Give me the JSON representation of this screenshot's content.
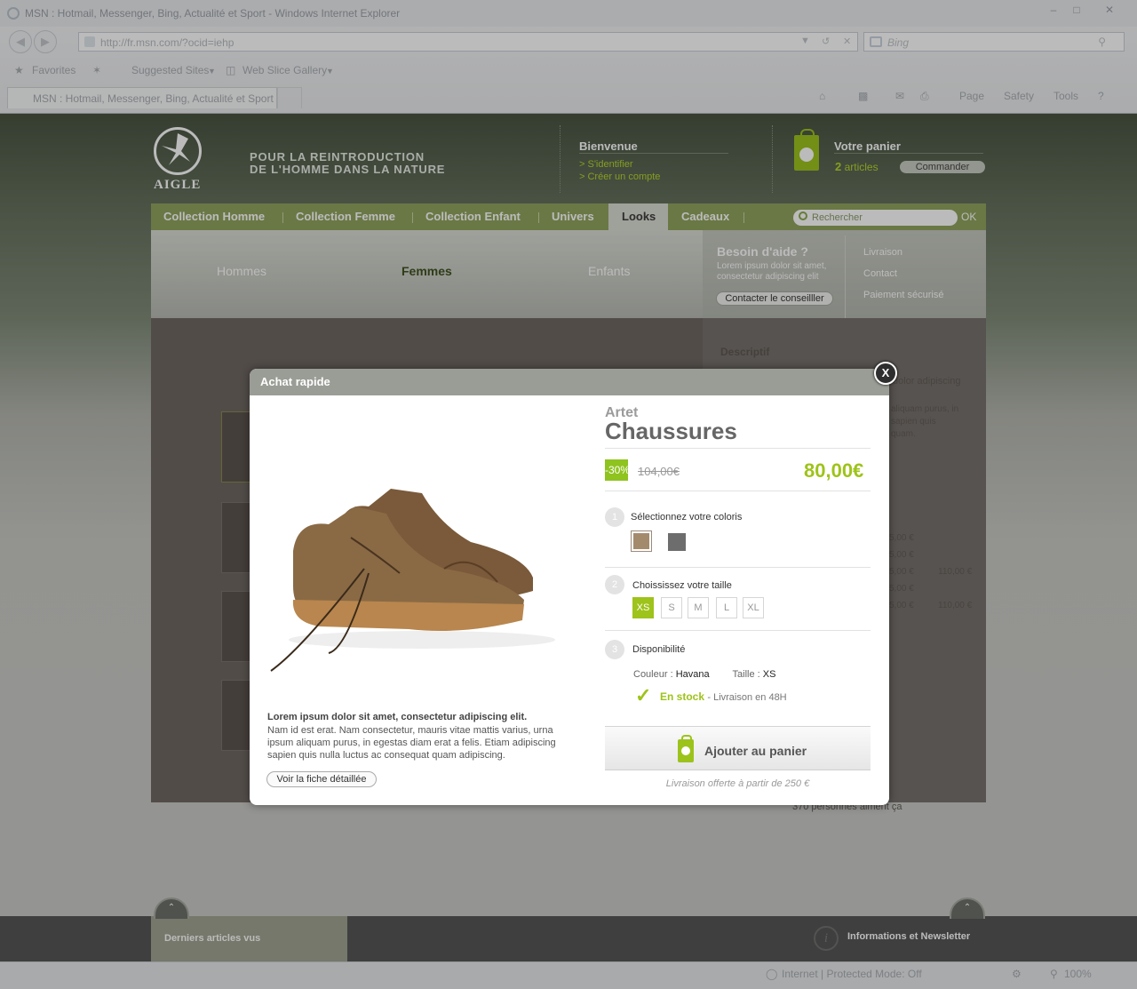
{
  "browser": {
    "window_title": "MSN : Hotmail, Messenger, Bing, Actualité et Sport - Windows Internet Explorer",
    "url": "http://fr.msn.com/?ocid=iehp",
    "search_placeholder": "Bing",
    "favorites": [
      "Favorites",
      "Suggested Sites",
      "Web Slice Gallery"
    ],
    "tab_title": "MSN : Hotmail, Messenger, Bing, Actualité et Sport",
    "commands": [
      "Page",
      "Safety",
      "Tools"
    ],
    "status": {
      "zone": "Internet | Protected Mode: Off",
      "zoom": "100%"
    }
  },
  "header": {
    "brand": "AIGLE",
    "tagline": [
      "POUR LA REINTRODUCTION",
      "DE L'HOMME DANS LA NATURE"
    ],
    "welcome": {
      "title": "Bienvenue",
      "links": [
        "> S'identifier",
        "> Créer un compte"
      ]
    },
    "cart": {
      "title": "Votre panier",
      "count": "2",
      "count_label": "articles",
      "order_button": "Commander"
    }
  },
  "nav": {
    "items": [
      "Collection Homme",
      "Collection Femme",
      "Collection Enfant",
      "Univers",
      "Looks",
      "Cadeaux"
    ],
    "active": "Looks",
    "search_placeholder": "Rechercher",
    "search_button": "OK"
  },
  "subnav": {
    "items": [
      "Hommes",
      "Femmes",
      "Enfants"
    ],
    "active": "Femmes",
    "help": {
      "title": "Besoin d'aide ?",
      "text": "Lorem ipsum dolor sit amet, consectetur adipiscing elit",
      "button": "Contacter le conseilller"
    },
    "links": [
      "Livraison",
      "Contact",
      "Paiement sécurisé"
    ]
  },
  "background_page": {
    "section_title": "Descriptif",
    "text_fragments": [
      "dolor adipiscing",
      "aliquam purus, in",
      "sapien quis",
      "quam."
    ],
    "prices": [
      "5,00 €",
      "5,00 €",
      "5,00 €",
      "5,00 €",
      "5,00 €"
    ],
    "old_prices": [
      "110,00 €",
      "110,00 €"
    ],
    "social": "370 personnes aiment ça"
  },
  "footer": {
    "recent": "Derniers articles vus",
    "info": "Informations et Newsletter"
  },
  "modal": {
    "title": "Achat rapide",
    "close": "X",
    "product": {
      "brand": "Artet",
      "name": "Chaussures",
      "discount": "-30%",
      "old_price": "104,00€",
      "price": "80,00€",
      "lead": "Lorem ipsum dolor sit amet, consectetur adipiscing elit.",
      "description": "Nam id est erat. Nam consectetur, mauris vitae mattis varius, urna ipsum aliquam purus, in egestas diam erat a felis. Etiam adipiscing sapien quis nulla luctus ac consequat quam adipiscing.",
      "detail_button": "Voir la fiche détaillée"
    },
    "steps": [
      {
        "num": "1",
        "label": "Sélectionnez votre coloris"
      },
      {
        "num": "2",
        "label": "Choississez votre taille"
      },
      {
        "num": "3",
        "label": "Disponibilité"
      }
    ],
    "colors": [
      {
        "name": "Havana",
        "hex": "#a48a6d",
        "selected": true
      },
      {
        "name": "grey",
        "hex": "#6d6d6d",
        "selected": false
      }
    ],
    "sizes": [
      {
        "label": "XS",
        "selected": true
      },
      {
        "label": "S",
        "selected": false
      },
      {
        "label": "M",
        "selected": false
      },
      {
        "label": "L",
        "selected": false
      },
      {
        "label": "XL",
        "selected": false
      }
    ],
    "availability": {
      "color_label": "Couleur :",
      "color_value": "Havana",
      "size_label": "Taille :",
      "size_value": "XS",
      "stock": "En stock",
      "delivery": "- Livraison en 48H"
    },
    "add_to_cart": "Ajouter au panier",
    "delivery_note": "Livraison offerte à partir de 250 €"
  },
  "colors": {
    "accent_green": "#9ec31a",
    "nav_green": "#8fa35c"
  }
}
